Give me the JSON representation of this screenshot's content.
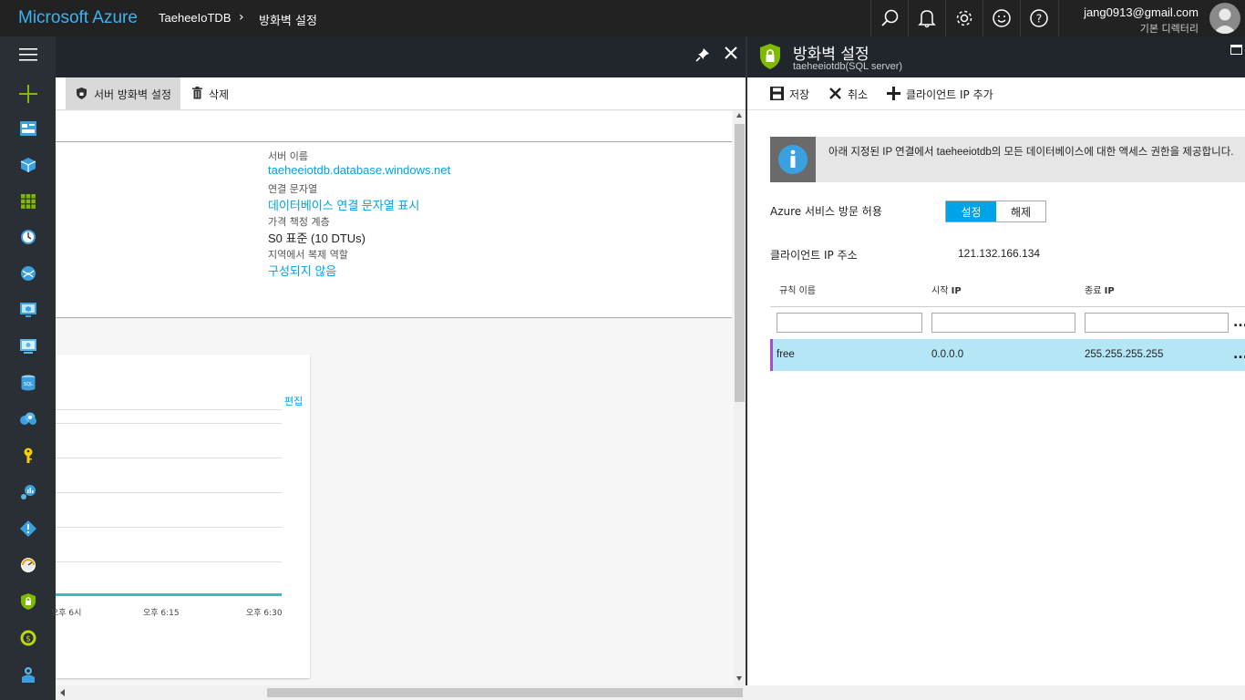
{
  "topbar": {
    "brand": "Microsoft Azure",
    "breadcrumb_1": "TaeheeIoTDB",
    "breadcrumb_sep": "›",
    "breadcrumb_2": "방화벽 설정",
    "icons": [
      "search-icon",
      "bell-icon",
      "gear-icon",
      "smiley-icon",
      "help-icon"
    ],
    "user_email": "jang0913@gmail.com",
    "user_directory": "기본 디렉터리"
  },
  "sidebar": {
    "icons": [
      "hamburger-menu-icon",
      "new-plus-icon",
      "dashboard-icon",
      "resource-group-icon",
      "all-resources-icon",
      "recent-clock-icon",
      "app-services-icon",
      "virtual-machine-icon",
      "vm-classic-icon",
      "sql-database-icon",
      "cloud-services-icon",
      "key-vault-icon",
      "insights-icon",
      "advisor-icon",
      "monitor-gauge-icon",
      "security-center-icon",
      "cost-icon",
      "help-support-icon"
    ]
  },
  "left_blade": {
    "commands": {
      "firewall_label": "서버 방화벽 설정",
      "delete_label": "삭제"
    },
    "properties": {
      "server_name_label": "서버 이름",
      "server_name_value": "taeheeiotdb.database.windows.net",
      "connection_string_label": "연결 문자열",
      "connection_string_value": "데이터베이스 연결 문자열 표시",
      "pricing_tier_label": "가격 책정 계층",
      "pricing_tier_value": "S0 표준 (10 DTUs)",
      "geo_replication_label": "지역에서 복제 역할",
      "geo_replication_value": "구성되지 않음"
    },
    "chart": {
      "edit_label": "편집",
      "x_ticks": [
        "오후 6시",
        "오후 6:15",
        "오후 6:30"
      ]
    }
  },
  "right_blade": {
    "title": "방화벽 설정",
    "subtitle": "taeheeiotdb(SQL server)",
    "commands": {
      "save_label": "저장",
      "cancel_label": "취소",
      "add_client_ip_label": "클라이언트 IP 추가"
    },
    "info_text": "아래 지정된 IP 연결에서 taeheeiotdb의 모든 데이터베이스에 대한 액세스 권한을 제공합니다.",
    "azure_access_label": "Azure 서비스 방문 허용",
    "toggle_on": "설정",
    "toggle_off": "해제",
    "client_ip_label": "클라이언트 IP 주소",
    "client_ip_value": "121.132.166.134",
    "table": {
      "headers": {
        "rule_name": "규칙 이름",
        "start_ip_prefix": "시작 ",
        "start_ip_suffix": "IP",
        "end_ip_prefix": "종료 ",
        "end_ip_suffix": "IP"
      },
      "rows": [
        {
          "rule_name": "free",
          "start_ip": "0.0.0.0",
          "end_ip": "255.255.255.255"
        }
      ],
      "more_label": "..."
    }
  },
  "colors": {
    "brand_blue": "#3ab4f0",
    "link_blue": "#00a2e8",
    "selected_row": "#b4e6f5",
    "row_marker": "#a94cd8",
    "shield_green": "#7fba00"
  }
}
